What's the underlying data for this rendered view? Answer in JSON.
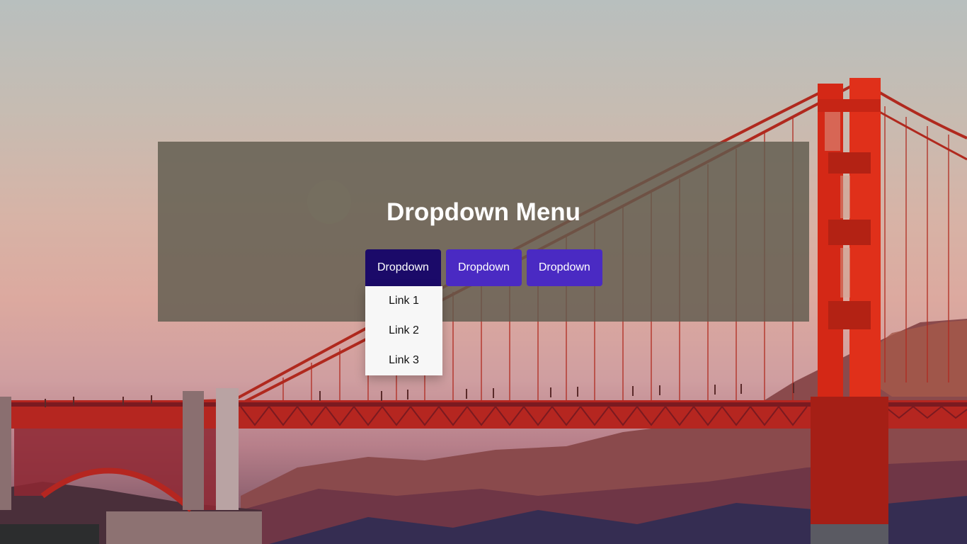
{
  "page": {
    "title": "Dropdown Menu"
  },
  "dropdowns": [
    {
      "label": "Dropdown",
      "open": true,
      "links": [
        "Link 1",
        "Link 2",
        "Link 3"
      ]
    },
    {
      "label": "Dropdown",
      "open": false
    },
    {
      "label": "Dropdown",
      "open": false
    }
  ],
  "colors": {
    "button": "#4a2ac3",
    "button_active": "#1b0a69",
    "menu_bg": "#f7f7f7",
    "bridge": "#d22a1c"
  }
}
